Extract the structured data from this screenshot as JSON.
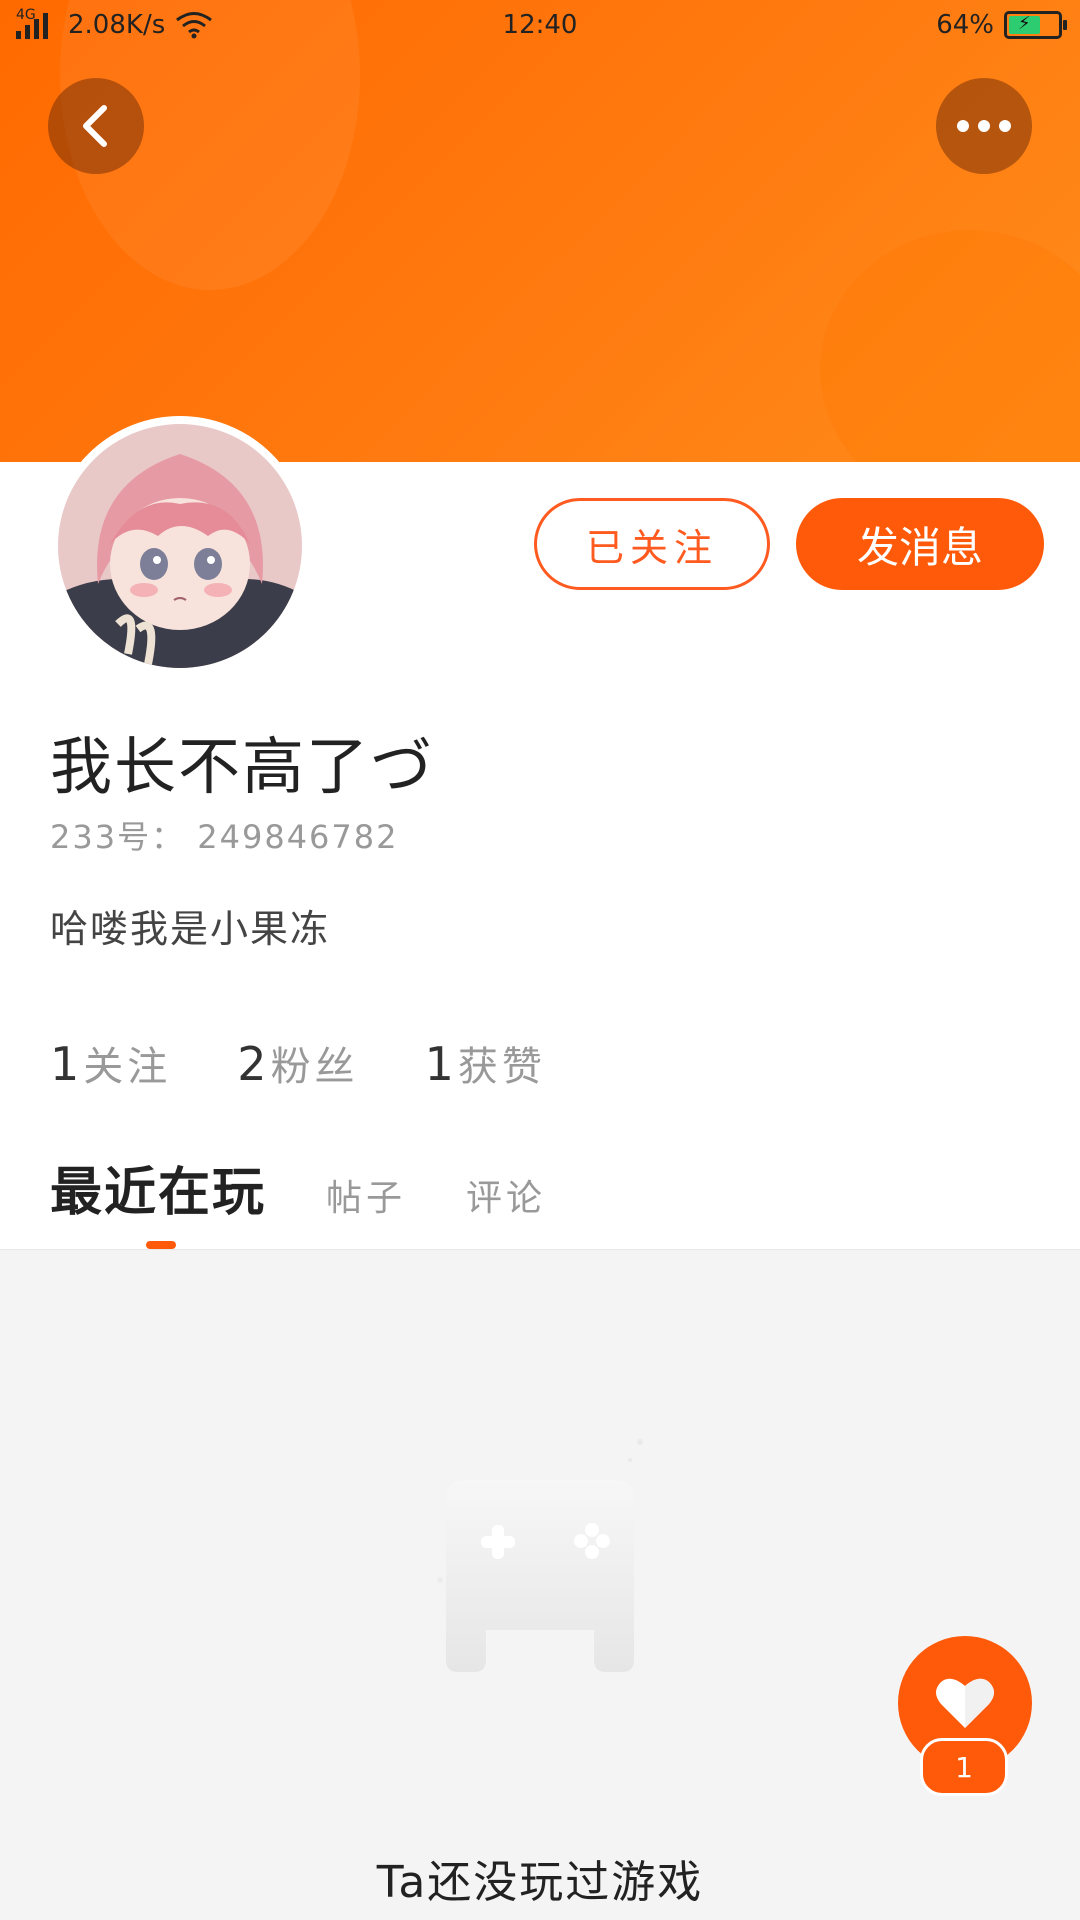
{
  "status_bar": {
    "network": "4G",
    "speed": "2.08K/s",
    "time": "12:40",
    "battery": "64%",
    "battery_level": 0.64
  },
  "icons": {
    "back": "chevron-left-icon",
    "more": "more-horizontal-icon",
    "like": "heart-icon",
    "empty": "gamepad-icon"
  },
  "actions": {
    "followed_label": "已关注",
    "message_label": "发消息"
  },
  "profile": {
    "username": "我长不高了づ",
    "uid": "233号： 249846782",
    "bio": "哈喽我是小果冻"
  },
  "stats": [
    {
      "value": "1",
      "label": "关注"
    },
    {
      "value": "2",
      "label": "粉丝"
    },
    {
      "value": "1",
      "label": "获赞"
    }
  ],
  "tabs": [
    {
      "label": "最近在玩",
      "active": true
    },
    {
      "label": "帖子",
      "active": false
    },
    {
      "label": "评论",
      "active": false
    }
  ],
  "empty_state": {
    "message": "Ta还没玩过游戏"
  },
  "like_fab": {
    "count": "1"
  },
  "colors": {
    "accent": "#ff5a0a",
    "banner": "#ff7a10",
    "background": "#f4f4f4"
  }
}
